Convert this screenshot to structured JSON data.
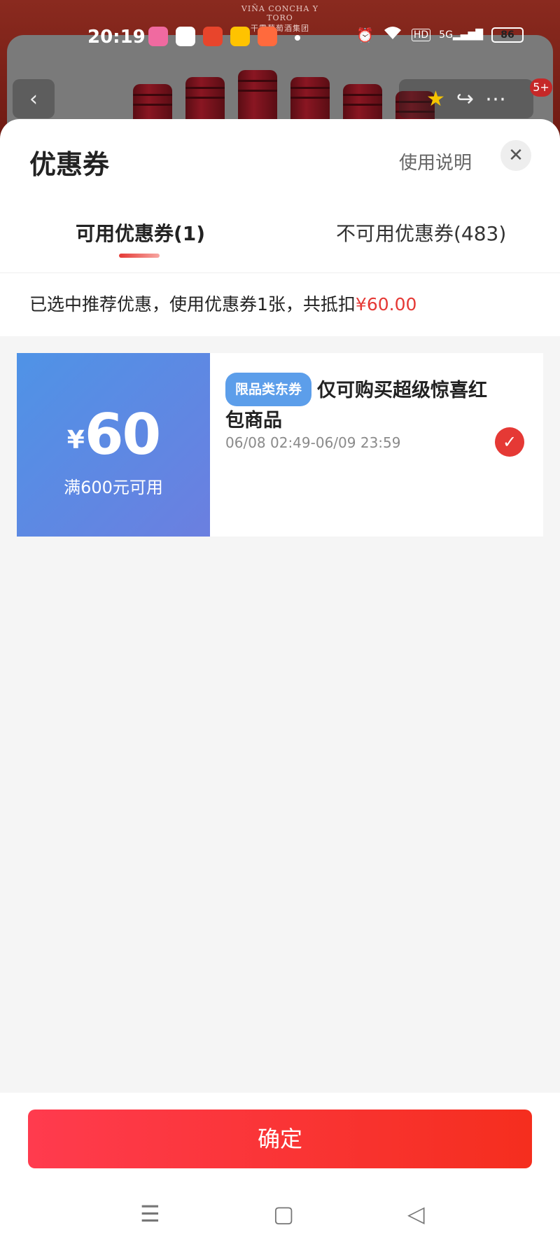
{
  "status_bar": {
    "time": "20:19",
    "battery": "86",
    "hd": "HD",
    "signal": "5G"
  },
  "background": {
    "brand_text": "VIÑA CONCHA Y TORO",
    "brand_sub": "干露葡萄酒集团",
    "notification_badge": "5+"
  },
  "sheet": {
    "title": "优惠券",
    "help_link": "使用说明"
  },
  "tabs": {
    "available": "可用优惠券(1)",
    "unavailable": "不可用优惠券(483)"
  },
  "summary": {
    "text": "已选中推荐优惠，使用优惠券1张，共抵扣",
    "amount": "¥60.00"
  },
  "coupons": [
    {
      "currency": "¥",
      "amount": "60",
      "condition": "满600元可用",
      "tag": "限品类东券",
      "description": "仅可购买超级惊喜红包商品",
      "validity": "06/08 02:49-06/09 23:59",
      "selected": true
    }
  ],
  "footer": {
    "confirm_label": "确定"
  },
  "colors": {
    "accent_red": "#e53935",
    "coupon_blue_start": "#4f93e6",
    "coupon_blue_end": "#6b7fe0",
    "tag_blue": "#5c9eea"
  }
}
